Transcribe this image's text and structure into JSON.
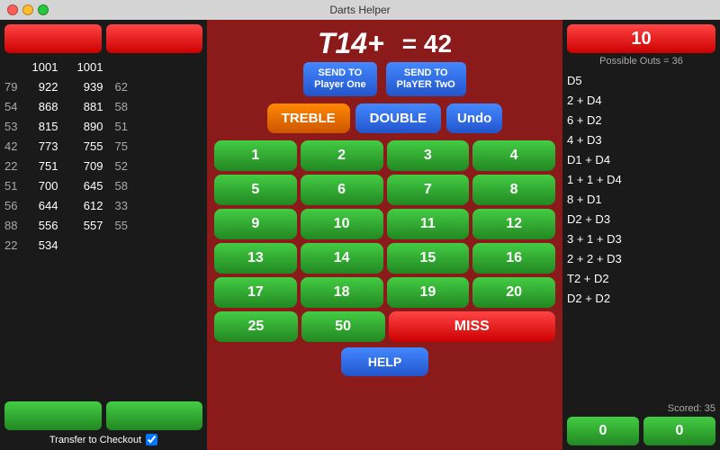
{
  "titleBar": {
    "title": "Darts Helper"
  },
  "leftPanel": {
    "topBtns": [
      "",
      ""
    ],
    "scoreData": {
      "col1": [
        "79",
        "54",
        "53",
        "42",
        "22",
        "51",
        "56",
        "88",
        "22"
      ],
      "col2_a": [
        "1001",
        "922",
        "868",
        "815",
        "773",
        "751",
        "700",
        "644",
        "556",
        "534"
      ],
      "col2_b": [
        "1001",
        "939",
        "881",
        "890",
        "755",
        "709",
        "645",
        "612",
        "557"
      ],
      "col3": [
        "62",
        "58",
        "51",
        "75",
        "52",
        "58",
        "33",
        "55"
      ]
    },
    "bottomBtn1": "",
    "bottomBtn2": "",
    "transferLabel": "Transfer to Checkout",
    "transferChecked": true
  },
  "centerPanel": {
    "dartCode": "T14+",
    "equalsScore": "= 42",
    "sendToPlayer1": "SEND TO\nPlayer One",
    "sendToPlayer1Line1": "SEND TO",
    "sendToPlayer1Line2": "Player One",
    "sendToPlayer2Line1": "SEND TO",
    "sendToPlayer2Line2": "PlaYER TwO",
    "trebleLabel": "TREBLE",
    "doubleLabel": "DOUBLE",
    "undoLabel": "Undo",
    "numbers": [
      "1",
      "2",
      "3",
      "4",
      "5",
      "6",
      "7",
      "8",
      "9",
      "10",
      "11",
      "12",
      "13",
      "14",
      "15",
      "16",
      "17",
      "18",
      "19",
      "20"
    ],
    "btn25": "25",
    "btn50": "50",
    "missLabel": "MISS",
    "helpLabel": "HELP"
  },
  "rightPanel": {
    "currentScore": "10",
    "possibleOuts": "Possible Outs = 36",
    "checkouts": [
      "D5",
      "2 + D4",
      "6 + D2",
      "4 + D3",
      "D1 + D4",
      "1 + 1 + D4",
      "8 + D1",
      "D2 + D3",
      "3 + 1 + D3",
      "2 + 2 + D3",
      "T2 + D2",
      "D2 + D2"
    ],
    "scoredLabel": "Scored: 35",
    "score1": "0",
    "score2": "0"
  }
}
